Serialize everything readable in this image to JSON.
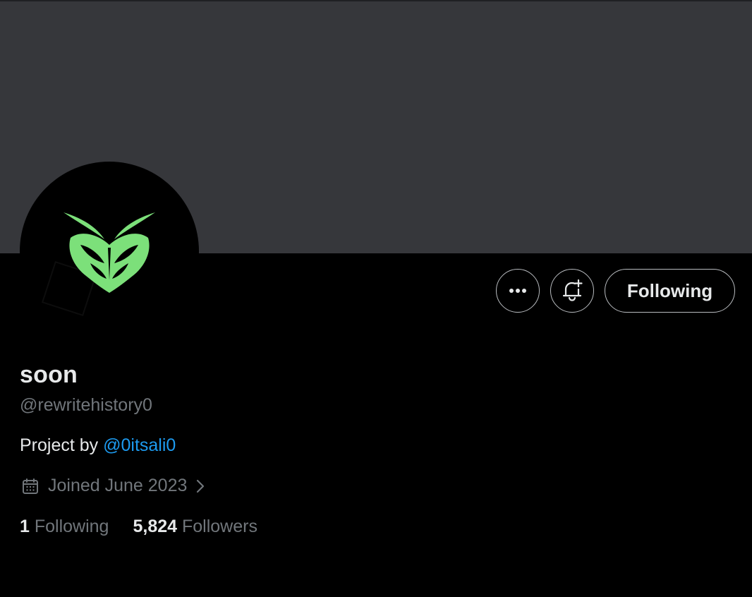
{
  "profile": {
    "display_name": "soon",
    "handle": "@rewritehistory0",
    "bio_prefix": "Project by ",
    "bio_mention": "@0itsali0",
    "joined": "Joined June 2023"
  },
  "actions": {
    "more_icon": "more-horizontal-icon",
    "notify_icon": "bell-plus-icon",
    "follow_label": "Following"
  },
  "stats": {
    "following_count": "1",
    "following_label": "Following",
    "followers_count": "5,824",
    "followers_label": "Followers"
  },
  "colors": {
    "banner": "#36373b",
    "background": "#000000",
    "text_primary": "#e7e9ea",
    "text_secondary": "#71767b",
    "link": "#1d9bf0",
    "avatar_logo": "#7ce07a"
  }
}
